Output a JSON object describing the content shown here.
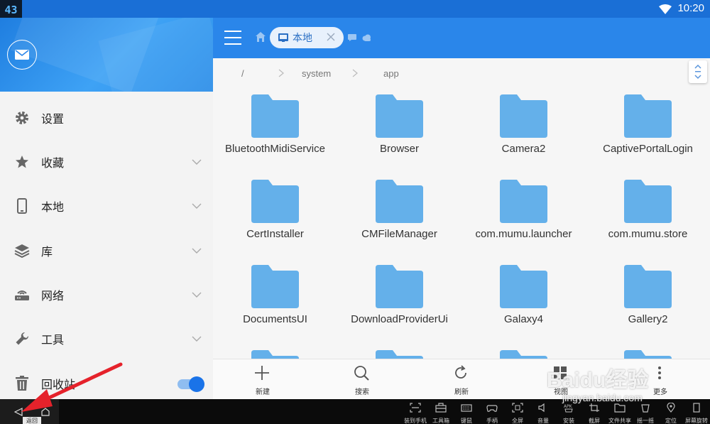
{
  "status_bar": {
    "badge": "43",
    "time": "10:20"
  },
  "drawer": {
    "items": [
      {
        "label": "设置",
        "icon": "gear-icon",
        "expandable": false
      },
      {
        "label": "收藏",
        "icon": "star-icon",
        "expandable": true
      },
      {
        "label": "本地",
        "icon": "phone-icon",
        "expandable": true
      },
      {
        "label": "库",
        "icon": "layers-icon",
        "expandable": true
      },
      {
        "label": "网络",
        "icon": "router-icon",
        "expandable": true
      },
      {
        "label": "工具",
        "icon": "wrench-icon",
        "expandable": true
      },
      {
        "label": "回收站",
        "icon": "trash-icon",
        "toggle": true
      }
    ]
  },
  "appbar": {
    "tab_label": "本地"
  },
  "path": {
    "segments": [
      "/",
      "system",
      "app"
    ]
  },
  "files": [
    "BluetoothMidiService",
    "Browser",
    "Camera2",
    "CaptivePortalLogin",
    "CertInstaller",
    "CMFileManager",
    "com.mumu.launcher",
    "com.mumu.store",
    "DocumentsUI",
    "DownloadProviderUi",
    "Galaxy4",
    "Gallery2",
    "",
    "",
    "",
    ""
  ],
  "bottom_actions": [
    {
      "label": "新建",
      "icon": "plus-icon"
    },
    {
      "label": "搜索",
      "icon": "search-icon"
    },
    {
      "label": "刷新",
      "icon": "refresh-icon"
    },
    {
      "label": "视图",
      "icon": "grid-view-icon"
    },
    {
      "label": "更多",
      "icon": "more-icon"
    }
  ],
  "emulator": {
    "tooltip": "返回",
    "tools": [
      "装到手机",
      "工具箱",
      "键鼠",
      "手柄",
      "全屏",
      "音量",
      "安装",
      "截屏",
      "文件共享",
      "摇一摇",
      "定位",
      "屏幕旋转"
    ]
  },
  "watermark": {
    "brand": "Baidu经验",
    "url": "jingyan.baidu.com"
  },
  "colors": {
    "primary": "#2a86ea",
    "folder": "#64b0ea",
    "toggle": "#1a73e8",
    "arrow": "#e5222b"
  }
}
